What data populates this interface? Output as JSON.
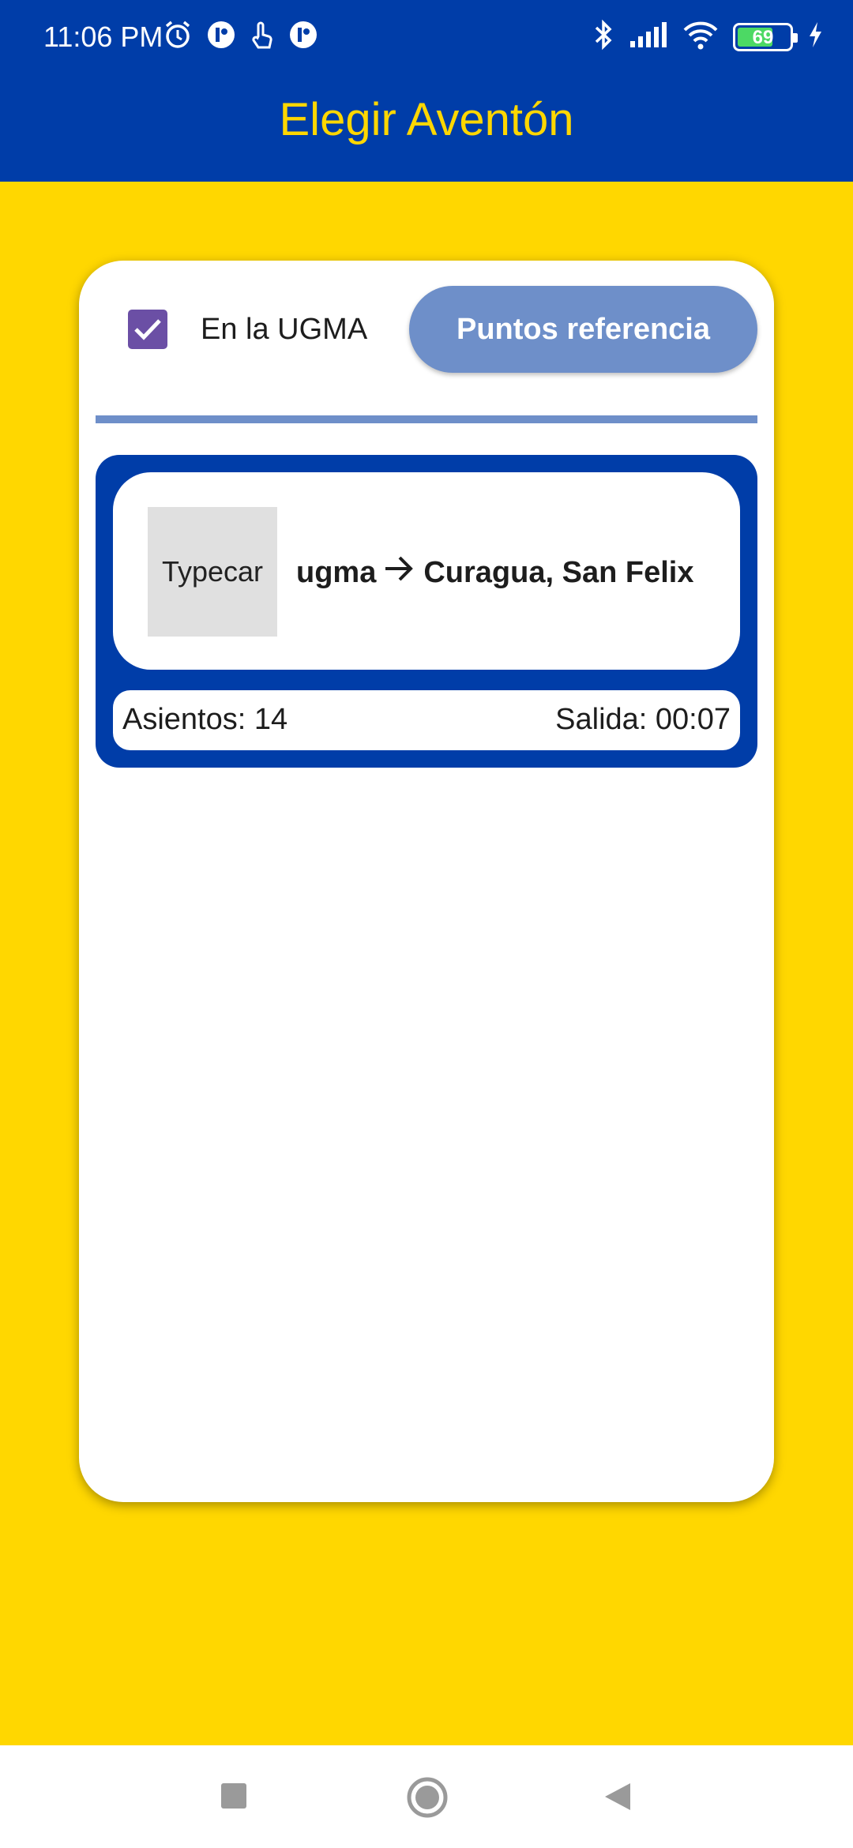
{
  "status_bar": {
    "time": "11:06 PM",
    "battery_level": "69",
    "battery_fraction": 0.69,
    "icons_left": [
      "alarm-icon",
      "app-notification-icon",
      "touch-icon",
      "app-notification-icon"
    ],
    "icons_right": [
      "bluetooth-icon",
      "signal-icon",
      "wifi-icon",
      "battery-icon",
      "charging-icon"
    ]
  },
  "app_bar": {
    "title": "Elegir Aventón"
  },
  "filter": {
    "checkbox_label": "En la UGMA",
    "checked": true,
    "button_label": "Puntos referencia"
  },
  "rides": [
    {
      "vehicle": "Typecar",
      "origin": "ugma",
      "destination": "Curagua, San Felix",
      "seats": "Asientos: 14",
      "departure": "Salida: 00:07"
    }
  ],
  "colors": {
    "primary": "#003DA8",
    "accent": "#FFD700",
    "button": "#6E8FC9",
    "checkbox": "#6B4FA5"
  },
  "nav_bar": {
    "buttons": [
      "recents-button",
      "home-button",
      "back-button"
    ]
  }
}
